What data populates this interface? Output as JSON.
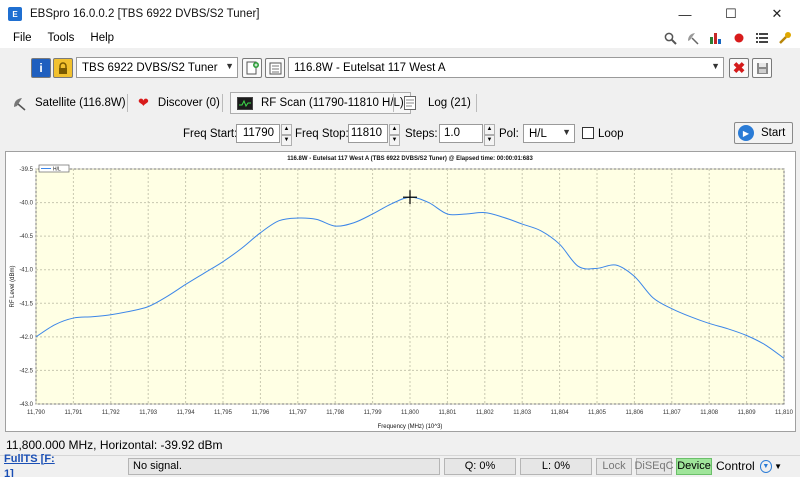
{
  "window": {
    "title": "EBSpro 16.0.0.2 [TBS 6922 DVBS/S2 Tuner]",
    "controls": {
      "minimize": "—",
      "maximize": "☐",
      "close": "✕"
    }
  },
  "menu": [
    "File",
    "Tools",
    "Help"
  ],
  "device": {
    "tuner": "TBS 6922 DVBS/S2 Tuner",
    "satellite": "116.8W - Eutelsat 117 West A"
  },
  "tabs": [
    {
      "label": "Satellite (116.8W)"
    },
    {
      "label": "Discover (0)"
    },
    {
      "label": "RF Scan (11790-11810 H/L)"
    },
    {
      "label": "Log (21)"
    }
  ],
  "scan": {
    "freq_start_label": "Freq Start:",
    "freq_start": "11790",
    "freq_stop_label": "Freq Stop:",
    "freq_stop": "11810",
    "steps_label": "Steps:",
    "steps": "1.0",
    "pol_label": "Pol:",
    "pol": "H/L",
    "loop_label": "Loop",
    "start_label": "Start"
  },
  "chart_data": {
    "type": "line",
    "title": "116.8W - Eutelsat 117 West A (TBS 6922 DVBS/S2 Tuner) @ Elapsed time: 00:00:01:683",
    "xlabel": "Frequency (MHz) (10^3)",
    "ylabel": "RF Level (dBm)",
    "legend": "H/L",
    "legend_position": "top-left",
    "xlim": [
      11.79,
      11.81
    ],
    "ylim": [
      -43.0,
      -39.5
    ],
    "x_ticks": [
      "11,790",
      "11,791",
      "11,792",
      "11,793",
      "11,794",
      "11,795",
      "11,796",
      "11,797",
      "11,798",
      "11,799",
      "11,800",
      "11,801",
      "11,802",
      "11,803",
      "11,804",
      "11,805",
      "11,806",
      "11,807",
      "11,808",
      "11,809",
      "11,810"
    ],
    "y_ticks": [
      "-39.5",
      "-40.0",
      "-40.5",
      "-41.0",
      "-41.5",
      "-42.0",
      "-42.5",
      "-43.0"
    ],
    "background": "#ffffe4",
    "line_color": "#3c86e8",
    "cursor": {
      "x": 11.8,
      "y": -39.92
    },
    "series": [
      {
        "name": "H/L",
        "x": [
          11.79,
          11.7905,
          11.791,
          11.7915,
          11.792,
          11.7925,
          11.793,
          11.7935,
          11.794,
          11.7945,
          11.795,
          11.7955,
          11.796,
          11.7965,
          11.797,
          11.7975,
          11.798,
          11.7985,
          11.799,
          11.7995,
          11.8,
          11.8005,
          11.801,
          11.8015,
          11.802,
          11.8025,
          11.803,
          11.8035,
          11.804,
          11.8045,
          11.805,
          11.8055,
          11.806,
          11.8065,
          11.807,
          11.8075,
          11.808,
          11.8085,
          11.809,
          11.8095,
          11.81
        ],
        "y": [
          -42.0,
          -41.82,
          -41.72,
          -41.7,
          -41.67,
          -41.62,
          -41.55,
          -41.4,
          -41.22,
          -41.05,
          -40.88,
          -40.68,
          -40.45,
          -40.27,
          -40.23,
          -40.25,
          -40.35,
          -40.3,
          -40.17,
          -40.02,
          -39.92,
          -40.0,
          -40.17,
          -40.17,
          -40.15,
          -40.22,
          -40.32,
          -40.42,
          -40.62,
          -40.95,
          -40.98,
          -40.93,
          -41.1,
          -41.42,
          -41.58,
          -41.7,
          -41.8,
          -41.88,
          -41.98,
          -42.12,
          -42.32
        ]
      }
    ]
  },
  "readout": "11,800.000 MHz, Horizontal: -39.92 dBm",
  "status": {
    "fullts": "FullTS [F: 1]",
    "signal": "No signal.",
    "quality": "Q: 0%",
    "level": "L: 0%",
    "lock": "Lock",
    "diseqc": "DiSEqC",
    "device": "Device",
    "control": "Control"
  }
}
